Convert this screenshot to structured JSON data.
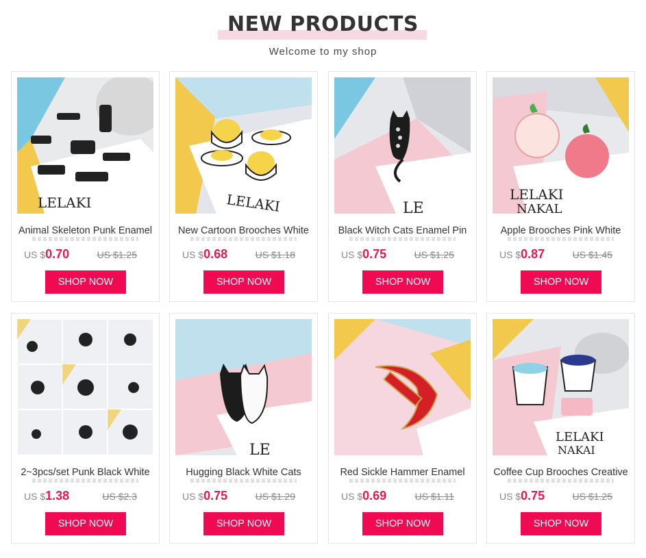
{
  "header": {
    "title": "NEW PRODUCTS",
    "subtitle": "Welcome to my shop"
  },
  "colors": {
    "accent": "#ef0a52",
    "price": "#e8184f",
    "title_highlight": "#f7d9e2"
  },
  "products": [
    {
      "name": "Animal Skeleton Punk Enamel",
      "currency": "US $",
      "price": "0.70",
      "old_price": "US $1.25",
      "button": "SHOP NOW",
      "image": "dinosaur-skeleton-pins"
    },
    {
      "name": "New Cartoon Brooches White",
      "currency": "US $",
      "price": "0.68",
      "old_price": "US $1.18",
      "button": "SHOP NOW",
      "image": "egg-yolk-pins"
    },
    {
      "name": "Black Witch Cats Enamel Pin",
      "currency": "US $",
      "price": "0.75",
      "old_price": "US $1.25",
      "button": "SHOP NOW",
      "image": "black-cat-pin"
    },
    {
      "name": "Apple Brooches Pink White",
      "currency": "US $",
      "price": "0.87",
      "old_price": "US $1.45",
      "button": "SHOP NOW",
      "image": "apple-teacher-pins"
    },
    {
      "name": "2~3pcs/set Punk Black White",
      "currency": "US $",
      "price": "1.38",
      "old_price": "US $2.3",
      "button": "SHOP NOW",
      "image": "punk-pin-collage"
    },
    {
      "name": "Hugging Black White Cats",
      "currency": "US $",
      "price": "0.75",
      "old_price": "US $1.29",
      "button": "SHOP NOW",
      "image": "hugging-cats-pin"
    },
    {
      "name": "Red Sickle Hammer Enamel",
      "currency": "US $",
      "price": "0.69",
      "old_price": "US $1.11",
      "button": "SHOP NOW",
      "image": "sickle-hammer-pin"
    },
    {
      "name": "Coffee Cup Brooches Creative",
      "currency": "US $",
      "price": "0.75",
      "old_price": "US $1.25",
      "button": "SHOP NOW",
      "image": "coffee-cup-pins"
    }
  ]
}
